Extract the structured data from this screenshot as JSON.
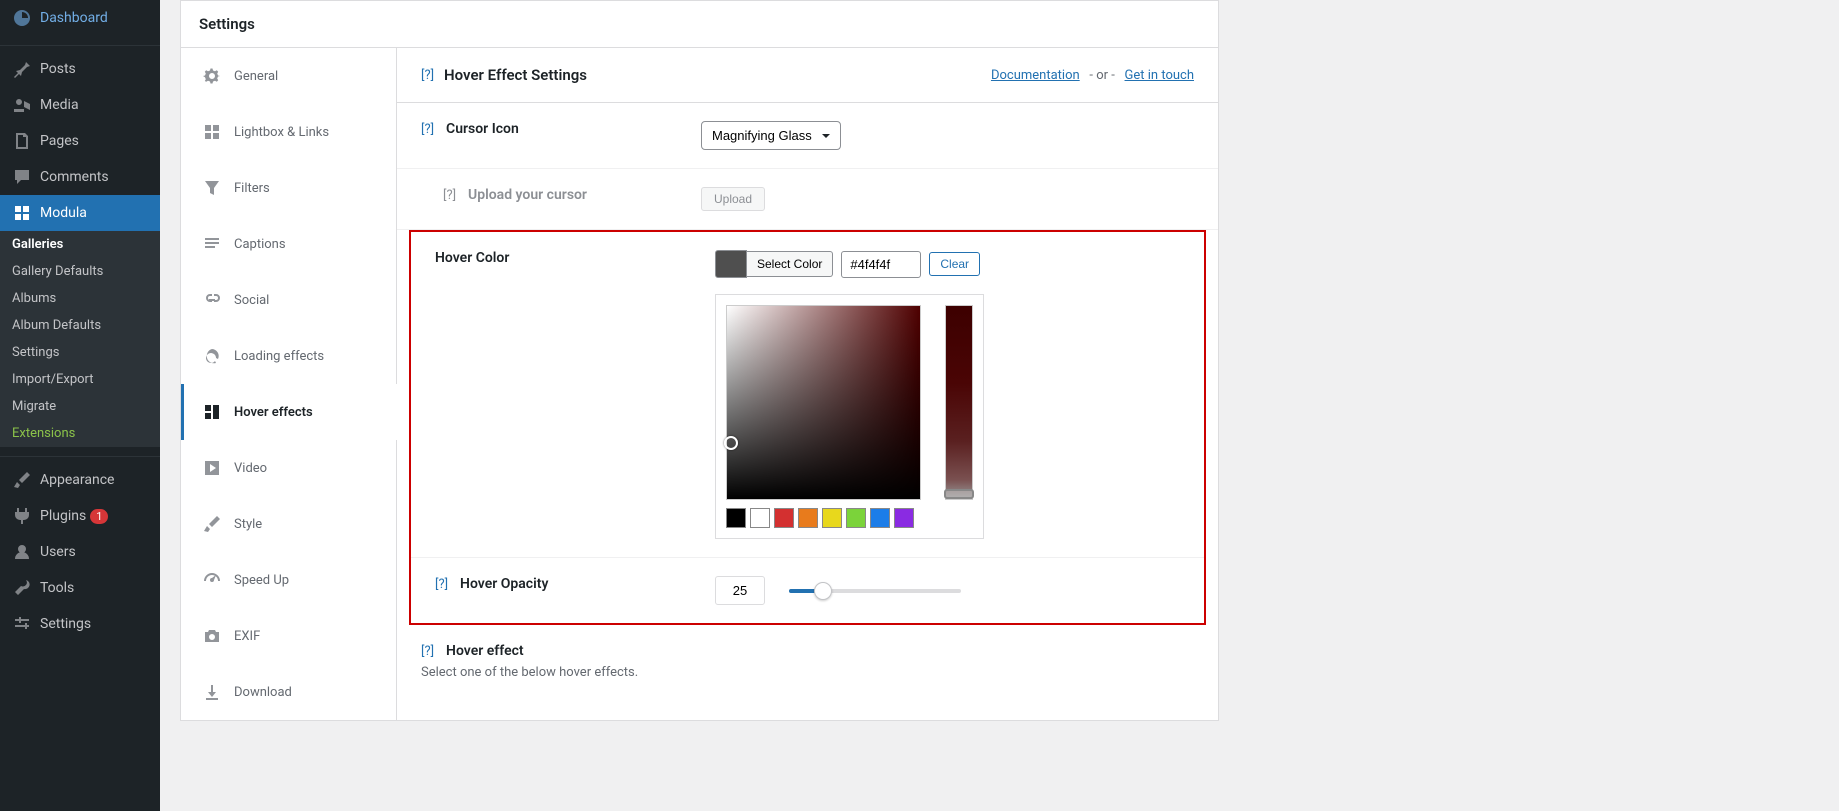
{
  "sidebar": {
    "items": [
      {
        "icon": "dashboard",
        "label": "Dashboard"
      },
      {
        "icon": "pin",
        "label": "Posts"
      },
      {
        "icon": "media",
        "label": "Media"
      },
      {
        "icon": "pages",
        "label": "Pages"
      },
      {
        "icon": "comments",
        "label": "Comments"
      },
      {
        "icon": "modula",
        "label": "Modula",
        "active": true
      },
      {
        "icon": "appearance",
        "label": "Appearance"
      },
      {
        "icon": "plugins",
        "label": "Plugins",
        "badge": "1"
      },
      {
        "icon": "users",
        "label": "Users"
      },
      {
        "icon": "tools",
        "label": "Tools"
      },
      {
        "icon": "settings",
        "label": "Settings"
      }
    ],
    "submenu": [
      {
        "label": "Galleries",
        "current": true
      },
      {
        "label": "Gallery Defaults"
      },
      {
        "label": "Albums"
      },
      {
        "label": "Album Defaults"
      },
      {
        "label": "Settings"
      },
      {
        "label": "Import/Export"
      },
      {
        "label": "Migrate"
      },
      {
        "label": "Extensions",
        "ext": true
      }
    ]
  },
  "settings": {
    "title": "Settings",
    "tabs": [
      {
        "icon": "gear",
        "label": "General"
      },
      {
        "icon": "grid",
        "label": "Lightbox & Links"
      },
      {
        "icon": "filter",
        "label": "Filters"
      },
      {
        "icon": "captions",
        "label": "Captions"
      },
      {
        "icon": "social",
        "label": "Social"
      },
      {
        "icon": "loading",
        "label": "Loading effects"
      },
      {
        "icon": "hover",
        "label": "Hover effects",
        "active": true
      },
      {
        "icon": "video",
        "label": "Video"
      },
      {
        "icon": "style",
        "label": "Style"
      },
      {
        "icon": "speed",
        "label": "Speed Up"
      },
      {
        "icon": "exif",
        "label": "EXIF"
      },
      {
        "icon": "download",
        "label": "Download"
      }
    ]
  },
  "content": {
    "header": {
      "help": "[?]",
      "title": "Hover Effect Settings",
      "doc_label": "Documentation",
      "sep": "-  or  -",
      "touch_label": "Get in touch"
    },
    "cursor": {
      "help": "[?]",
      "label": "Cursor Icon",
      "selected": "Magnifying Glass"
    },
    "upload": {
      "help": "[?]",
      "label": "Upload your cursor",
      "button": "Upload"
    },
    "hovercolor": {
      "label": "Hover Color",
      "select_label": "Select Color",
      "hex": "#4f4f4f",
      "clear": "Clear",
      "swatches": [
        "#000000",
        "#ffffff",
        "#d33030",
        "#e87b1c",
        "#e8d81c",
        "#7bd33a",
        "#1c7de8",
        "#8a2be2"
      ]
    },
    "opacity": {
      "help": "[?]",
      "label": "Hover Opacity",
      "value": "25"
    },
    "effect": {
      "help": "[?]",
      "label": "Hover effect",
      "desc": "Select one of the below hover effects."
    }
  }
}
